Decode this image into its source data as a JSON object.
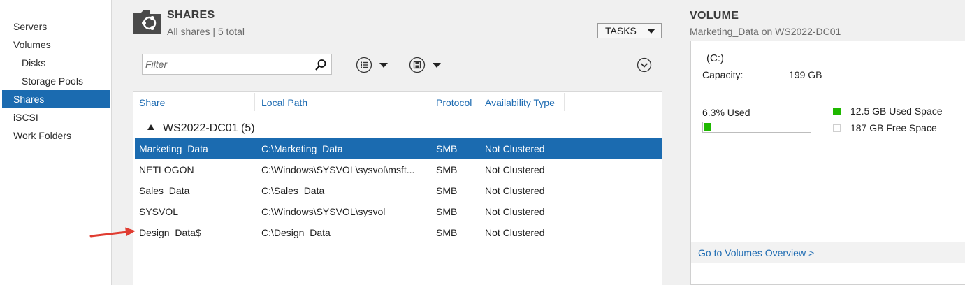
{
  "nav": {
    "items": [
      {
        "label": "Servers"
      },
      {
        "label": "Volumes"
      },
      {
        "label": "Disks"
      },
      {
        "label": "Storage Pools"
      },
      {
        "label": "Shares"
      },
      {
        "label": "iSCSI"
      },
      {
        "label": "Work Folders"
      }
    ],
    "active": "Shares"
  },
  "shares": {
    "title": "SHARES",
    "subtitle": "All shares | 5 total",
    "tasks_label": "TASKS",
    "filter_placeholder": "Filter",
    "columns": [
      "Share",
      "Local Path",
      "Protocol",
      "Availability Type"
    ],
    "group_label": "WS2022-DC01 (5)",
    "rows": [
      {
        "share": "Marketing_Data",
        "path": "C:\\Marketing_Data",
        "protocol": "SMB",
        "availability": "Not Clustered",
        "selected": true
      },
      {
        "share": "NETLOGON",
        "path": "C:\\Windows\\SYSVOL\\sysvol\\msft...",
        "protocol": "SMB",
        "availability": "Not Clustered",
        "selected": false
      },
      {
        "share": "Sales_Data",
        "path": "C:\\Sales_Data",
        "protocol": "SMB",
        "availability": "Not Clustered",
        "selected": false
      },
      {
        "share": "SYSVOL",
        "path": "C:\\Windows\\SYSVOL\\sysvol",
        "protocol": "SMB",
        "availability": "Not Clustered",
        "selected": false
      },
      {
        "share": "Design_Data$",
        "path": "C:\\Design_Data",
        "protocol": "SMB",
        "availability": "Not Clustered",
        "selected": false
      }
    ]
  },
  "volume": {
    "title": "VOLUME",
    "subtitle": "Marketing_Data on WS2022-DC01",
    "drive": "(C:)",
    "capacity_label": "Capacity:",
    "capacity_value": "199 GB",
    "used_label": "6.3% Used",
    "used_fraction": 0.063,
    "used_space_label": "12.5 GB Used Space",
    "free_space_label": "187 GB Free Space",
    "overview_link": "Go to Volumes Overview >"
  },
  "colors": {
    "accent": "#1b6bb0",
    "link": "#1d6bb2",
    "used": "#1fb800",
    "annotation_arrow": "#e03c31"
  },
  "icons": [
    "shares-folder-icon",
    "search-icon",
    "list-view-icon",
    "save-icon",
    "expand-circle-icon",
    "annotation-arrow-icon"
  ]
}
